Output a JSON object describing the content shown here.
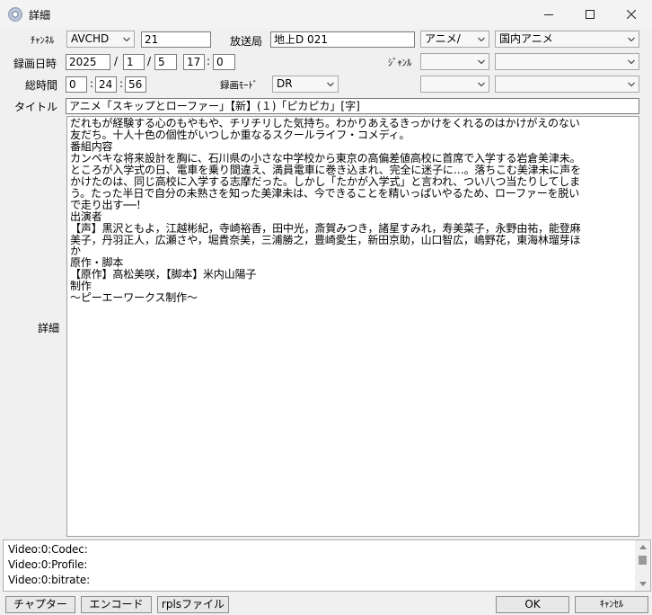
{
  "window": {
    "title": "詳細"
  },
  "form": {
    "channel_label": "ﾁｬﾝﾈﾙ",
    "channel_type": "AVCHD",
    "channel_number": "21",
    "station_label": "放送局",
    "station_value": "地上D 021",
    "genre_main": "アニメ/",
    "genre_sub": "国内アニメ",
    "date_label": "録画日時",
    "year": "2025",
    "month": "1",
    "day": "5",
    "hour": "17",
    "minute": "0",
    "date_sep": "/",
    "time_sep": ":",
    "genre_label": "ｼﾞｬﾝﾙ",
    "duration_label": "総時間",
    "dur_h": "0",
    "dur_m": "24",
    "dur_s": "56",
    "mode_label": "録画ﾓｰﾄﾞ",
    "mode_value": "DR",
    "title_label": "タイトル",
    "title_value": "アニメ「スキップとローファー」【新】(１)「ピカピカ」[字]",
    "detail_label": "詳細"
  },
  "description_lines": [
    "だれもが経験する心のもやもや、チリチリした気持ち。わかりあえるきっかけをくれるのはかけがえのない",
    "友だち。十人十色の個性がいつしか重なるスクールライフ・コメディ。",
    "番組内容",
    "カンペキな将来設計を胸に、石川県の小さな中学校から東京の高偏差値高校に首席で入学する岩倉美津未。",
    "ところが入学式の日、電車を乗り間違え、満員電車に巻き込まれ、完全に迷子に…。落ちこむ美津未に声を",
    "かけたのは、同じ高校に入学する志摩だった。しかし「たかが入学式」と言われ、つい八つ当たりしてしま",
    "う。たった半日で自分の未熟さを知った美津未は、今できることを精いっぱいやるため、ローファーを脱い",
    "で走り出す──！",
    "出演者",
    "【声】黒沢ともよ，江越彬紀，寺崎裕香，田中光，斎賀みつき，諸星すみれ，寿美菜子，永野由祐，能登麻",
    "美子，丹羽正人，広瀬さや，堀貴奈美，三浦勝之，豊崎愛生，新田京助，山口智広，嶋野花，東海林瑠芽ほ",
    "か",
    "原作・脚本",
    "【原作】高松美咲，【脚本】米内山陽子",
    "制作",
    "～ピーエーワークス制作～"
  ],
  "info_lines": [
    "Video:0:Codec:",
    "Video:0:Profile:",
    "Video:0:bitrate:"
  ],
  "buttons": {
    "chapter": "チャプター",
    "encode": "エンコード",
    "rpls": "rplsファイル",
    "ok": "OK",
    "cancel": "ｷｬﾝｾﾙ"
  }
}
